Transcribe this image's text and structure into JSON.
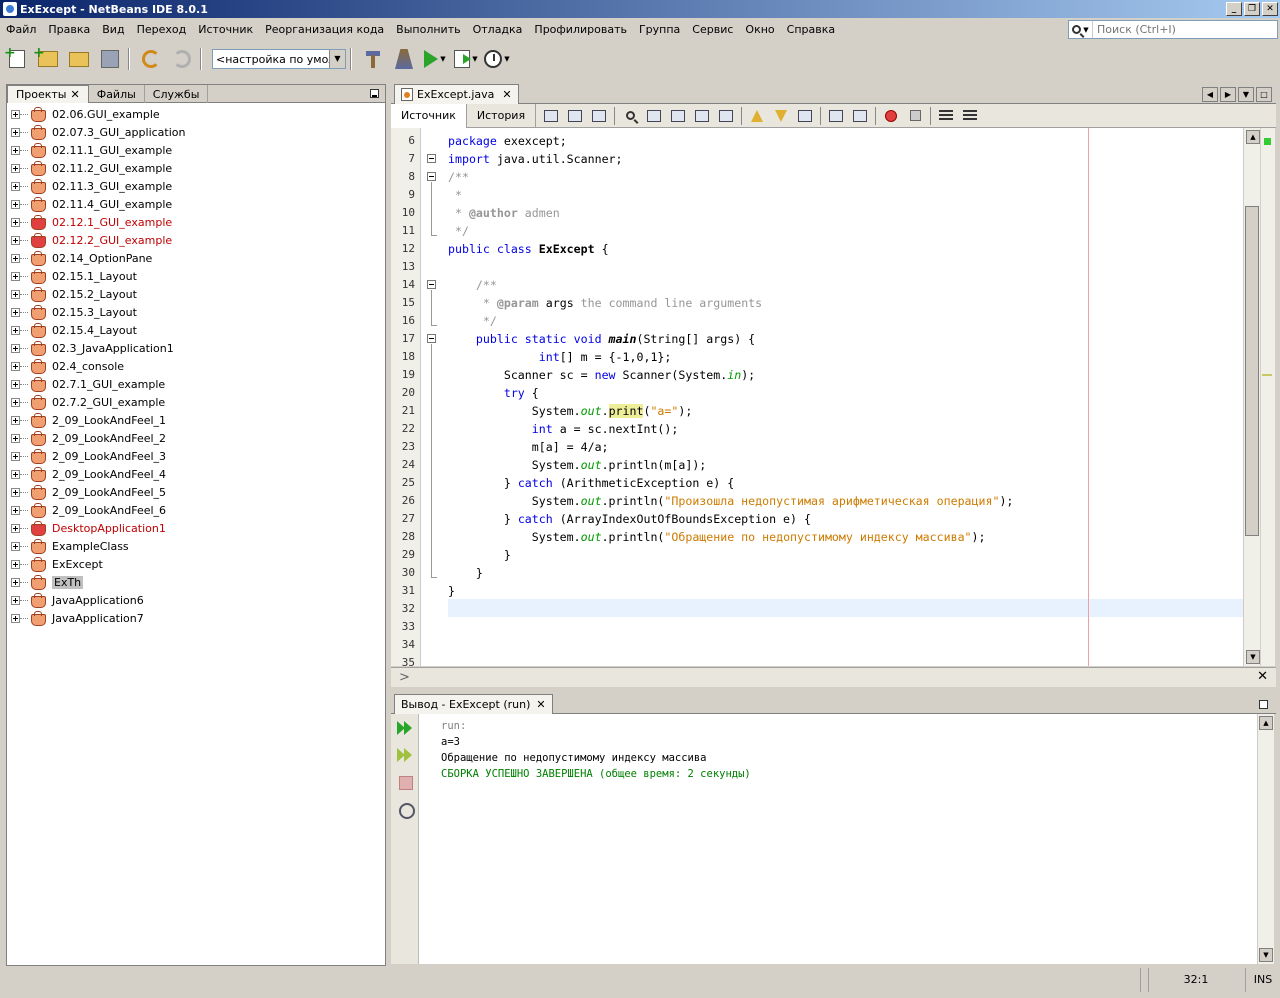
{
  "window": {
    "title": "ExExcept - NetBeans IDE 8.0.1",
    "buttons": [
      "_",
      "❐",
      "✕"
    ]
  },
  "menu": [
    "Файл",
    "Правка",
    "Вид",
    "Переход",
    "Источник",
    "Реорганизация кода",
    "Выполнить",
    "Отладка",
    "Профилировать",
    "Группа",
    "Сервис",
    "Окно",
    "Справка"
  ],
  "search": {
    "placeholder": "Поиск (Ctrl+I)"
  },
  "toolbar": {
    "config": "<настройка по умол..."
  },
  "left_panel": {
    "tabs": [
      "Проекты",
      "Файлы",
      "Службы"
    ],
    "tree": [
      {
        "label": "02.06.GUI_example",
        "red": false,
        "sel": false
      },
      {
        "label": "02.07.3_GUI_application",
        "red": false,
        "sel": false
      },
      {
        "label": "02.11.1_GUI_example",
        "red": false,
        "sel": false
      },
      {
        "label": "02.11.2_GUI_example",
        "red": false,
        "sel": false
      },
      {
        "label": "02.11.3_GUI_example",
        "red": false,
        "sel": false
      },
      {
        "label": "02.11.4_GUI_example",
        "red": false,
        "sel": false
      },
      {
        "label": "02.12.1_GUI_example",
        "red": true,
        "sel": false
      },
      {
        "label": "02.12.2_GUI_example",
        "red": true,
        "sel": false
      },
      {
        "label": "02.14_OptionPane",
        "red": false,
        "sel": false
      },
      {
        "label": "02.15.1_Layout",
        "red": false,
        "sel": false
      },
      {
        "label": "02.15.2_Layout",
        "red": false,
        "sel": false
      },
      {
        "label": "02.15.3_Layout",
        "red": false,
        "sel": false
      },
      {
        "label": "02.15.4_Layout",
        "red": false,
        "sel": false
      },
      {
        "label": "02.3_JavaApplication1",
        "red": false,
        "sel": false
      },
      {
        "label": "02.4_console",
        "red": false,
        "sel": false
      },
      {
        "label": "02.7.1_GUI_example",
        "red": false,
        "sel": false
      },
      {
        "label": "02.7.2_GUI_example",
        "red": false,
        "sel": false
      },
      {
        "label": "2_09_LookAndFeel_1",
        "red": false,
        "sel": false
      },
      {
        "label": "2_09_LookAndFeel_2",
        "red": false,
        "sel": false
      },
      {
        "label": "2_09_LookAndFeel_3",
        "red": false,
        "sel": false
      },
      {
        "label": "2_09_LookAndFeel_4",
        "red": false,
        "sel": false
      },
      {
        "label": "2_09_LookAndFeel_5",
        "red": false,
        "sel": false
      },
      {
        "label": "2_09_LookAndFeel_6",
        "red": false,
        "sel": false
      },
      {
        "label": "DesktopApplication1",
        "red": true,
        "sel": false
      },
      {
        "label": "ExampleClass",
        "red": false,
        "sel": false
      },
      {
        "label": "ExExcept",
        "red": false,
        "sel": false
      },
      {
        "label": "ExTh",
        "red": false,
        "sel": true
      },
      {
        "label": "JavaApplication6",
        "red": false,
        "sel": false
      },
      {
        "label": "JavaApplication7",
        "red": false,
        "sel": false
      }
    ]
  },
  "editor": {
    "tab": "ExExcept.java",
    "view_tabs": [
      "Источник",
      "История"
    ],
    "lines": [
      {
        "n": "6",
        "html": "<span class=\"kw\">package</span> exexcept;"
      },
      {
        "n": "7",
        "html": "<span class=\"kw\">import</span> java.util.Scanner;"
      },
      {
        "n": "8",
        "html": "<span class=\"cm\">/**</span>"
      },
      {
        "n": "9",
        "html": "<span class=\"cm\"> *</span>"
      },
      {
        "n": "10",
        "html": "<span class=\"cm\"> * <b>@author</b> admen</span>"
      },
      {
        "n": "11",
        "html": "<span class=\"cm\"> */</span>"
      },
      {
        "n": "12",
        "html": "<span class=\"kw\">public class</span> <span class=\"b\">ExExcept</span> {"
      },
      {
        "n": "13",
        "html": ""
      },
      {
        "n": "14",
        "html": "    <span class=\"cm\">/**</span>"
      },
      {
        "n": "15",
        "html": "<span class=\"cm\">     * <b>@param</b> </span>args<span class=\"cm\"> the command line arguments</span>"
      },
      {
        "n": "16",
        "html": "<span class=\"cm\">     */</span>"
      },
      {
        "n": "17",
        "html": "    <span class=\"kw\">public static void</span> <span class=\"bi\">main</span>(String[] args) {"
      },
      {
        "n": "18",
        "html": "             <span class=\"kw\">int</span>[] m = {-1,0,1};"
      },
      {
        "n": "19",
        "html": "        Scanner sc = <span class=\"kw\">new</span> Scanner(System.<span class=\"fi\">in</span>);"
      },
      {
        "n": "20",
        "html": "        <span class=\"kw\">try</span> {"
      },
      {
        "n": "21",
        "html": "            System.<span class=\"fi\">out</span>.<span class=\"hl\">print</span>(<span class=\"st\">\"a=\"</span>);"
      },
      {
        "n": "22",
        "html": "            <span class=\"kw\">int</span> a = sc.nextInt();"
      },
      {
        "n": "23",
        "html": "            m[a] = 4/a;"
      },
      {
        "n": "24",
        "html": "            System.<span class=\"fi\">out</span>.println(m[a]);"
      },
      {
        "n": "25",
        "html": "        } <span class=\"kw\">catch</span> (ArithmeticException e) {"
      },
      {
        "n": "26",
        "html": "            System.<span class=\"fi\">out</span>.println(<span class=\"st\">\"Произошла недопустимая арифметическая операция\"</span>);"
      },
      {
        "n": "27",
        "html": "        } <span class=\"kw\">catch</span> (ArrayIndexOutOfBoundsException e) {"
      },
      {
        "n": "28",
        "html": "            System.<span class=\"fi\">out</span>.println(<span class=\"st\">\"Обращение по недопустимому индексу массива\"</span>);"
      },
      {
        "n": "29",
        "html": "        }"
      },
      {
        "n": "30",
        "html": "    }"
      },
      {
        "n": "31",
        "html": "}"
      },
      {
        "n": "32",
        "html": ""
      },
      {
        "n": "33",
        "html": ""
      },
      {
        "n": "34",
        "html": ""
      },
      {
        "n": "35",
        "html": ""
      }
    ]
  },
  "output": {
    "tab": "Вывод - ExExcept (run)",
    "lines": [
      {
        "text": "run:",
        "color": "#808080"
      },
      {
        "text": "a=3",
        "color": "#000000"
      },
      {
        "text": "Обращение по недопустимому индексу массива",
        "color": "#000000"
      },
      {
        "text": "СБОРКА УСПЕШНО ЗАВЕРШЕНА (общее время: 2 секунды)",
        "color": "#008000"
      }
    ]
  },
  "status": {
    "position": "32:1",
    "mode": "INS"
  }
}
